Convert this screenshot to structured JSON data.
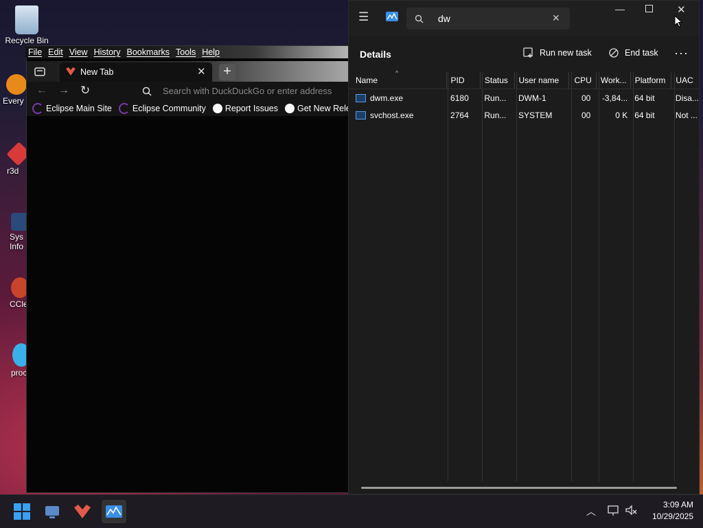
{
  "desktop": {
    "icons": [
      {
        "label": "Recycle Bin"
      },
      {
        "label": "Every"
      },
      {
        "label": "r3d"
      },
      {
        "label": "Sys Info"
      },
      {
        "label": "CCle"
      },
      {
        "label": "proc"
      }
    ]
  },
  "browser": {
    "menu": [
      "File",
      "Edit",
      "View",
      "History",
      "Bookmarks",
      "Tools",
      "Help"
    ],
    "tab_title": "New Tab",
    "address_placeholder": "Search with DuckDuckGo or enter address",
    "bookmarks": [
      "Eclipse Main Site",
      "Eclipse Community",
      "Report Issues",
      "Get New Releases"
    ]
  },
  "taskmanager": {
    "search_value": "dw",
    "page_title": "Details",
    "run_new_task": "Run new task",
    "end_task": "End task",
    "columns": [
      "Name",
      "PID",
      "Status",
      "User name",
      "CPU",
      "Work...",
      "Platform",
      "UAC"
    ],
    "rows": [
      {
        "name": "dwm.exe",
        "pid": "6180",
        "status": "Run...",
        "user": "DWM-1",
        "cpu": "00",
        "work": "-3,84...",
        "platform": "64 bit",
        "uac": "Disa..."
      },
      {
        "name": "svchost.exe",
        "pid": "2764",
        "status": "Run...",
        "user": "SYSTEM",
        "cpu": "00",
        "work": "0 K",
        "platform": "64 bit",
        "uac": "Not ..."
      }
    ]
  },
  "taskbar": {
    "time": "3:09 AM",
    "date": "10/29/2025"
  },
  "colors": {
    "accent": "#3a8ee6",
    "browser_tab_icon": "#e25a4a",
    "tm_bg": "#1c1c1c"
  }
}
